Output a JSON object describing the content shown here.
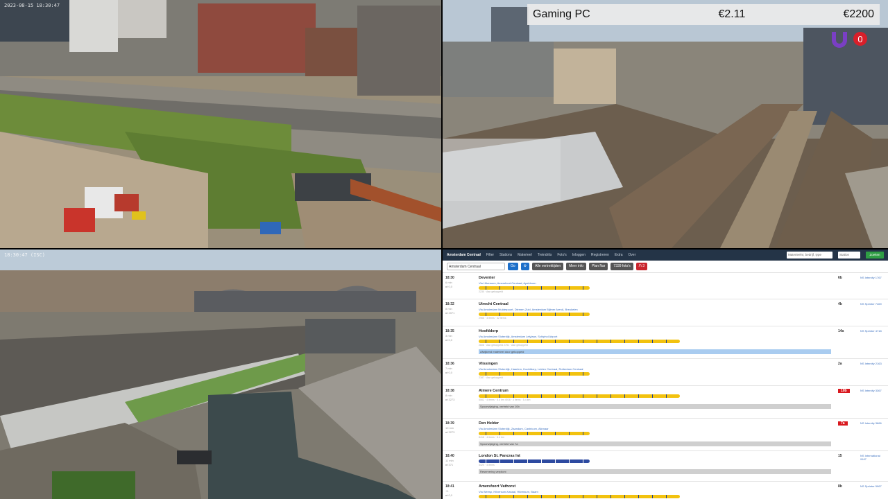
{
  "cams": {
    "top_left_stamp": "2023-08-15 18:30:47",
    "bottom_left_stamp": "18:30:47 (ISC)"
  },
  "overlay": {
    "name": "Gaming PC",
    "price": "€2.11",
    "goal": "€2200",
    "logo_icon": "live-counter-icon",
    "logo_value": "0"
  },
  "panel": {
    "brand": "Amsterdam Centraal",
    "nav": [
      "Filter",
      "Stations",
      "Materieel",
      "Treindrits",
      "Foto's",
      "Inloggen",
      "Registreren",
      "Extra",
      "Over"
    ],
    "search_placeholder": "Materieelnr, bedrijf, type",
    "search2_placeholder": "Station",
    "go_label": "Zoeken",
    "station_select": "Amsterdam Centraal",
    "go_btn": "Go",
    "buttons": [
      "Alle vertrektijden",
      "Meer info",
      "Plan Nar",
      "7339 foto's"
    ],
    "alert_btn": "/!\\ 3",
    "rows": [
      {
        "time": "18:30",
        "sub": "6 min\n⇄ 0,0",
        "dest": "Deventer",
        "via": "Via Hilversum, Amersfoort Centraal, Apeldoorn",
        "mat": "2230 · Aan gekoppeld",
        "plat": "6b",
        "plat_red": false,
        "kind": "NS Intercity 1767"
      },
      {
        "time": "18:32",
        "sub": "8 min\n⇄ 2071",
        "dest": "Utrecht Centraal",
        "via": "Via Amsterdam Muiderpoort, Diemen-Zuid, Amsterdam Bijlmer ArenA, Breukelen",
        "mat": "2966 · 4 items · 42 items",
        "plat": "4b",
        "plat_red": false,
        "kind": "NS Sprinter 7469"
      },
      {
        "time": "18:35",
        "sub": "3 min\n⇄ 0,0",
        "dest": "Hoofddorp",
        "via": "Via Amsterdam Sloterdijk, Amsterdam Lelylaan, Schiphol Airport",
        "mat": "2608 · Aan gekoppeld   2751 · Aan gekoppeld",
        "note": "Afwijkend materieel door gekoppeld",
        "note_info": true,
        "plat": "14a",
        "plat_red": false,
        "kind": "NS Sprinter 4718"
      },
      {
        "time": "18:36",
        "sub": "7 min\n⇄ 0,0",
        "dest": "Vlissingen",
        "via": "Via Amsterdam Sloterdijk, Haarlem, Hoofddorp, Leiden Centraal, Rotterdam Centraal",
        "mat": "2387 · Aan gekoppeld",
        "plat": "2a",
        "plat_red": false,
        "kind": "NS Intercity 2163"
      },
      {
        "time": "18:38",
        "sub": "8 min\n⇄ 3273",
        "dest": "Almere Centrum",
        "via": "",
        "mat": "4062 · 4 items · 5.4 km   4016 · 4 items · 5.4 km",
        "note": "Spoorwijziging, vertrekt van 10b",
        "note_info": false,
        "plat": "10b",
        "plat_red": true,
        "kind": "NS Intercity 3367"
      },
      {
        "time": "18:39",
        "sub": "10 min\n⇄ 3273",
        "dest": "Den Helder",
        "via": "Via Amsterdam Sloterdijk, Zaandam, Castricum, Alkmaar",
        "mat": "8418 · 4 items · 5.4 km",
        "note": "Spoorwijziging, vertrekt van 7a",
        "note_info": false,
        "plat": "7a",
        "plat_red": true,
        "kind": "NS Intercity 3666"
      },
      {
        "time": "18:40",
        "sub": "11 min\n⇄ 371",
        "dest": "London St. Pancras Int",
        "via": "",
        "mat": "4420 · 4 items",
        "note": "Reservering verplicht",
        "note_info": false,
        "plat": "15",
        "plat_red": false,
        "kind": "NS International 9167"
      },
      {
        "time": "18:41",
        "sub": "+1\n⇄ 0,0",
        "dest": "Amersfoort Vathorst",
        "via": "Via Weesp, Hilversum-Kanaal, Hilversum, Baarn",
        "mat": "2497 · 4 items · 42 items   2731 · 4 items · 42 items",
        "plat": "8b",
        "plat_red": false,
        "kind": "NS Sprinter 5967"
      }
    ]
  }
}
